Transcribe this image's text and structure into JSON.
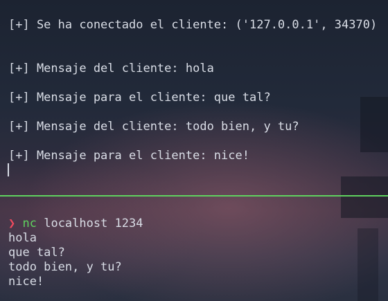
{
  "top_pane": {
    "lines": [
      "[+] Se ha conectado el cliente: ('127.0.0.1', 34370)",
      "[+] Mensaje del cliente: hola",
      "[+] Mensaje para el cliente: que tal?",
      "[+] Mensaje del cliente: todo bien, y tu?",
      "[+] Mensaje para el cliente: nice!"
    ]
  },
  "bottom_pane": {
    "prompt_symbol": "❯",
    "command_name": "nc",
    "command_args": " localhost 1234",
    "output": [
      "hola",
      "que tal?",
      "todo bien, y tu?",
      "nice!"
    ]
  },
  "colors": {
    "divider": "#5fd35f",
    "prompt_symbol": "#f04a5e",
    "command_name": "#5fd35f",
    "text": "#d9dde6"
  }
}
